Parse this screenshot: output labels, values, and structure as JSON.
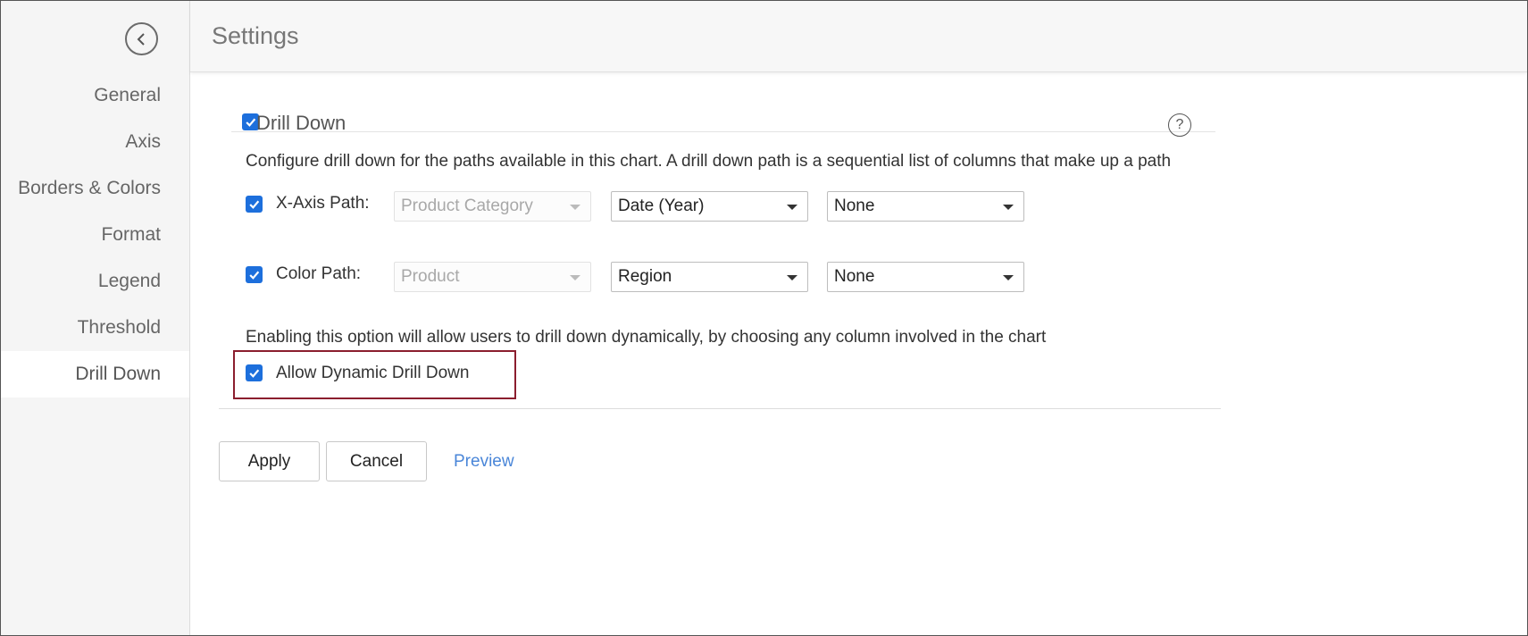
{
  "header": {
    "title": "Settings"
  },
  "sidebar": {
    "back_icon": "chevron-left-icon",
    "items": [
      {
        "label": "General"
      },
      {
        "label": "Axis"
      },
      {
        "label": "Borders & Colors"
      },
      {
        "label": "Format"
      },
      {
        "label": "Legend"
      },
      {
        "label": "Threshold"
      },
      {
        "label": "Drill Down",
        "active": true
      }
    ]
  },
  "drilldown": {
    "title": "Drill Down",
    "enabled": true,
    "help_icon": "?",
    "description": "Configure drill down for the paths available in this chart. A drill down path is a sequential list of columns that make up a path",
    "paths": [
      {
        "label": "X-Axis Path:",
        "checked": true,
        "selects": [
          "Product Category",
          "Date (Year)",
          "None"
        ]
      },
      {
        "label": "Color Path:",
        "checked": true,
        "selects": [
          "Product",
          "Region",
          "None"
        ]
      }
    ],
    "dynamic_description": "Enabling this option will allow users to drill down dynamically, by choosing any column involved in the chart",
    "dynamic_label": "Allow Dynamic Drill Down",
    "dynamic_checked": true
  },
  "actions": {
    "apply": "Apply",
    "cancel": "Cancel",
    "preview": "Preview"
  },
  "colors": {
    "accent": "#1d6fdc",
    "link": "#4a86d8",
    "highlight": "#8b1e2e"
  }
}
